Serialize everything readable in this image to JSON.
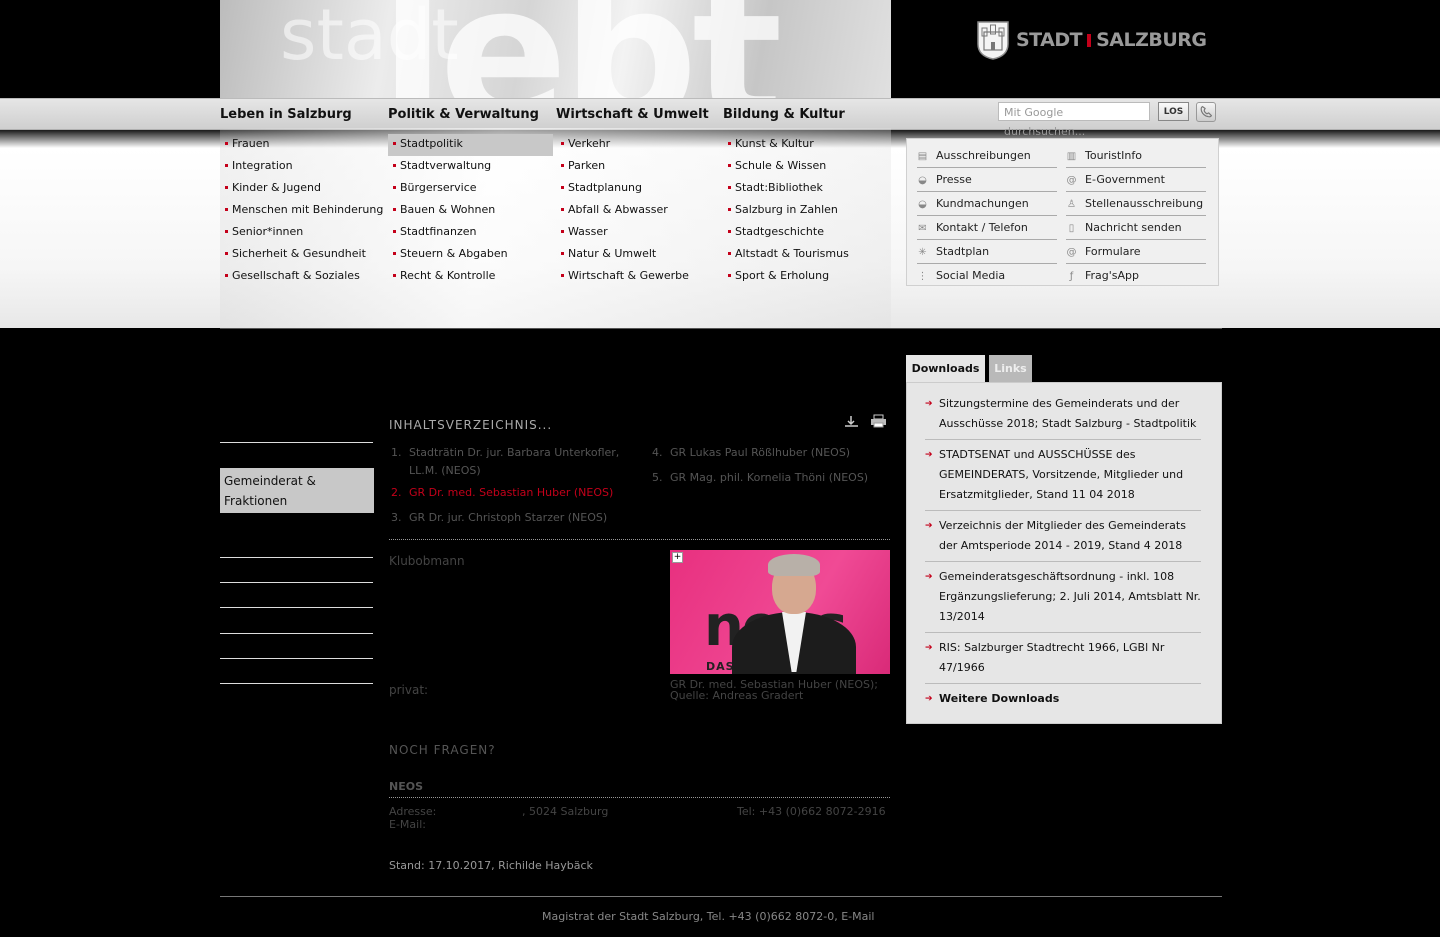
{
  "header": {
    "hero_text_large": "lebt",
    "hero_text_small": "stadt",
    "logo_part1": "STADT",
    "logo_part2": "SALZBURG",
    "search_placeholder": "Mit Google durchsuchen...",
    "search_button": "LOS"
  },
  "nav": {
    "top": [
      "Leben in Salzburg",
      "Politik & Verwaltung",
      "Wirtschaft & Umwelt",
      "Bildung & Kultur"
    ],
    "columns": [
      [
        "Frauen",
        "Integration",
        "Kinder & Jugend",
        "Menschen mit Behinderung",
        "Senior*innen",
        "Sicherheit & Gesundheit",
        "Gesellschaft & Soziales"
      ],
      [
        "Stadtpolitik",
        "Stadtverwaltung",
        "Bürgerservice",
        "Bauen & Wohnen",
        "Stadtfinanzen",
        "Steuern & Abgaben",
        "Recht & Kontrolle"
      ],
      [
        "Verkehr",
        "Parken",
        "Stadtplanung",
        "Abfall & Abwasser",
        "Wasser",
        "Natur & Umwelt",
        "Wirtschaft & Gewerbe"
      ],
      [
        "Kunst & Kultur",
        "Schule & Wissen",
        "Stadt:Bibliothek",
        "Salzburg in Zahlen",
        "Stadtgeschichte",
        "Altstadt & Tourismus",
        "Sport & Erholung"
      ]
    ],
    "active_item": "Stadtpolitik"
  },
  "quicklinks": {
    "left": [
      {
        "label": "Ausschreibungen",
        "icon": "document-icon"
      },
      {
        "label": "Presse",
        "icon": "bell-icon"
      },
      {
        "label": "Kundmachungen",
        "icon": "bell-icon"
      },
      {
        "label": "Kontakt / Telefon",
        "icon": "mail-icon"
      },
      {
        "label": "Stadtplan",
        "icon": "compass-icon"
      },
      {
        "label": "Social Media",
        "icon": "social-icon"
      }
    ],
    "right": [
      {
        "label": "TouristInfo",
        "icon": "info-icon"
      },
      {
        "label": "E-Government",
        "icon": "at-icon"
      },
      {
        "label": "Stellenausschreibung",
        "icon": "person-icon"
      },
      {
        "label": "Nachricht senden",
        "icon": "page-icon"
      },
      {
        "label": "Formulare",
        "icon": "at-icon"
      },
      {
        "label": "Frag'sApp",
        "icon": "app-icon"
      }
    ]
  },
  "leftnav": {
    "active": "Gemeinderat & Fraktionen"
  },
  "main": {
    "toc_title": "INHALTSVERZEICHNIS...",
    "toc": [
      {
        "num": "1.",
        "text": "Stadträtin Dr. jur. Barbara Unterkofler, LL.M. (NEOS)"
      },
      {
        "num": "2.",
        "text": "GR Dr. med. Sebastian Huber (NEOS)"
      },
      {
        "num": "3.",
        "text": "GR Dr. jur. Christoph Starzer (NEOS)"
      },
      {
        "num": "4.",
        "text": "GR Lukas Paul Rößlhuber (NEOS)"
      },
      {
        "num": "5.",
        "text": "GR Mag. phil. Kornelia Thöni (NEOS)"
      }
    ],
    "role": "Klubobmann",
    "privat_label": "privat:",
    "photo_text": "neos",
    "photo_subtext": "DAS N                H",
    "photo_caption": "GR Dr. med. Sebastian Huber (NEOS); Quelle: Andreas Gradert",
    "noch_fragen": "NOCH FRAGEN?",
    "contact_org": "NEOS",
    "address_label": "Adresse:",
    "address_city": ", 5024 Salzburg",
    "email_label": "E-Mail:",
    "tel": "Tel: +43 (0)662 8072-2916",
    "stand": "Stand: 17.10.2017, Richilde Haybäck"
  },
  "sidebar": {
    "tabs": [
      "Downloads",
      "Links"
    ],
    "downloads": [
      "Sitzungstermine des Gemeinderats und der Ausschüsse 2018; Stadt Salzburg - Stadtpolitik",
      "STADTSENAT und AUSSCHÜSSE des GEMEINDERATS, Vorsitzende, Mitglieder und Ersatzmitglieder, Stand 11 04 2018",
      "Verzeichnis der Mitglieder des Gemeinderats der Amtsperiode 2014 - 2019, Stand 4 2018",
      "Gemeinderatsgeschäftsordnung - inkl. 108 Ergänzungslieferung; 2. Juli 2014, Amtsblatt Nr. 13/2014",
      "RIS: Salzburger Stadtrecht 1966, LGBl Nr 47/1966"
    ],
    "more": "Weitere Downloads"
  },
  "footer": {
    "text": "Magistrat der Stadt Salzburg, Tel. +43 (0)662 8072-0, E-Mail"
  },
  "colors": {
    "accent_red": "#c4001a",
    "neos_pink": "#e8307f",
    "background": "#000000"
  }
}
